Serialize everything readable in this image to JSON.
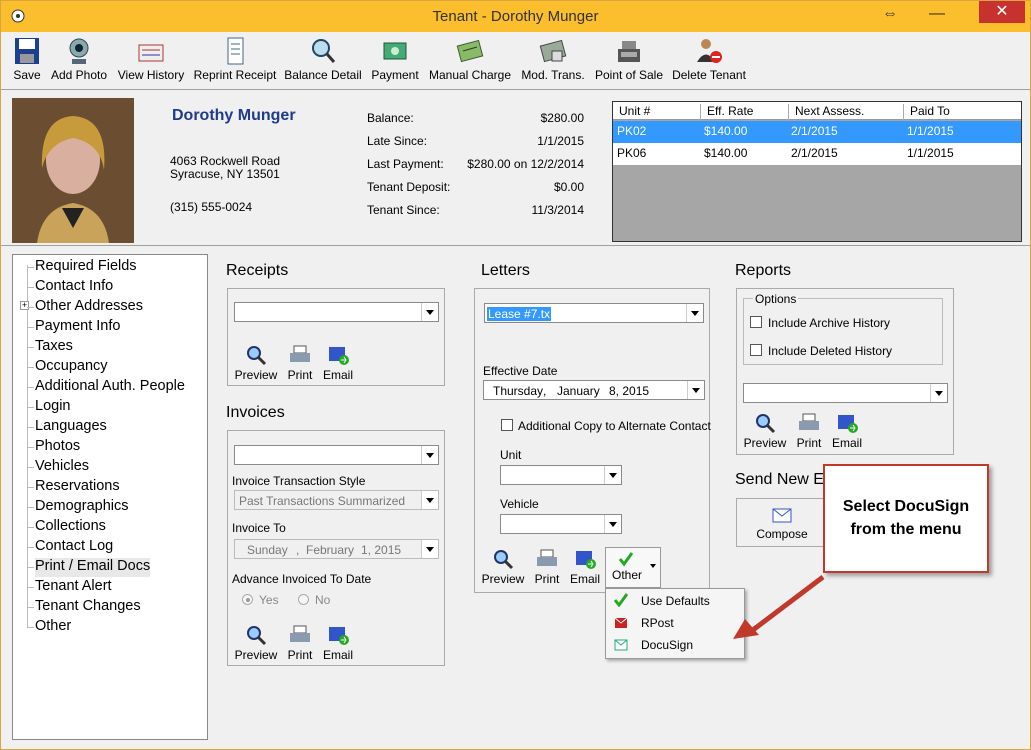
{
  "window": {
    "title": "Tenant - Dorothy Munger",
    "close_label": "✕",
    "minimize_label": "—",
    "resize_label": "⇔"
  },
  "toolbar": [
    {
      "label": "Save",
      "icon": "save-icon"
    },
    {
      "label": "Add Photo",
      "icon": "camera-icon"
    },
    {
      "label": "View History",
      "icon": "history-icon"
    },
    {
      "label": "Reprint Receipt",
      "icon": "receipt-icon"
    },
    {
      "label": "Balance Detail",
      "icon": "magnifier-chart-icon"
    },
    {
      "label": "Payment",
      "icon": "payment-icon"
    },
    {
      "label": "Manual Charge",
      "icon": "charge-icon"
    },
    {
      "label": "Mod. Trans.",
      "icon": "modify-transaction-icon"
    },
    {
      "label": "Point of Sale",
      "icon": "cash-register-icon"
    },
    {
      "label": "Delete Tenant",
      "icon": "delete-user-icon"
    }
  ],
  "tenant": {
    "name": "Dorothy Munger",
    "address1": "4063 Rockwell Road",
    "address2": "Syracuse, NY  13501",
    "phone": "(315) 555-0024"
  },
  "account": [
    {
      "label": "Balance:",
      "value": "$280.00"
    },
    {
      "label": "Late Since:",
      "value": "1/1/2015"
    },
    {
      "label": "Last Payment:",
      "value": "$280.00 on 12/2/2014"
    },
    {
      "label": "Tenant Deposit:",
      "value": "$0.00"
    },
    {
      "label": "Tenant Since:",
      "value": "11/3/2014"
    }
  ],
  "units": {
    "headers": [
      "Unit #",
      "Eff. Rate",
      "Next Assess.",
      "Paid To"
    ],
    "rows": [
      [
        "PK02",
        "$140.00",
        "2/1/2015",
        "1/1/2015"
      ],
      [
        "PK06",
        "$140.00",
        "2/1/2015",
        "1/1/2015"
      ]
    ]
  },
  "tree": [
    "Required Fields",
    "Contact Info",
    "Other Addresses",
    "Payment Info",
    "Taxes",
    "Occupancy",
    "Additional Auth. People",
    "Login",
    "Languages",
    "Photos",
    "Vehicles",
    "Reservations",
    "Demographics",
    "Collections",
    "Contact Log",
    "Print / Email Docs",
    "Tenant Alert",
    "Tenant Changes",
    "Other"
  ],
  "receipts": {
    "title": "Receipts",
    "preview": "Preview",
    "print": "Print",
    "email": "Email"
  },
  "invoices": {
    "title": "Invoices",
    "style_label": "Invoice Transaction Style",
    "style_value": "Past Transactions Summarized",
    "invoice_to_label": "Invoice To",
    "invoice_to_day": "Sunday",
    "invoice_to_month": "February",
    "invoice_to_date": "1, 2015",
    "advance_label": "Advance Invoiced To Date",
    "yes": "Yes",
    "no": "No",
    "preview": "Preview",
    "print": "Print",
    "email": "Email"
  },
  "letters": {
    "title": "Letters",
    "template": "Lease #7.tx",
    "effective_label": "Effective Date",
    "eff_day": "Thursday",
    "eff_month": "January",
    "eff_date": "8, 2015",
    "additional_copy": "Additional Copy to Alternate Contact",
    "unit_label": "Unit",
    "vehicle_label": "Vehicle",
    "preview": "Preview",
    "print": "Print",
    "email": "Email",
    "other": "Other"
  },
  "reports": {
    "title": "Reports",
    "options_label": "Options",
    "archive": "Include Archive History",
    "deleted": "Include Deleted History",
    "preview": "Preview",
    "print": "Print",
    "email": "Email"
  },
  "send_new": {
    "title": "Send New E",
    "compose": "Compose"
  },
  "menu": [
    {
      "label": "Use Defaults",
      "icon": "checkmark-icon"
    },
    {
      "label": "RPost",
      "icon": "rpost-icon"
    },
    {
      "label": "DocuSign",
      "icon": "docusign-icon"
    }
  ],
  "callout": {
    "line1": "Select DocuSign",
    "line2": "from the menu"
  },
  "colors": {
    "title_bar": "#fbbe2c",
    "close_button": "#c7312e",
    "selection": "#3399ff",
    "callout_border": "#c0392b",
    "tenant_name": "#1f3b8a"
  }
}
